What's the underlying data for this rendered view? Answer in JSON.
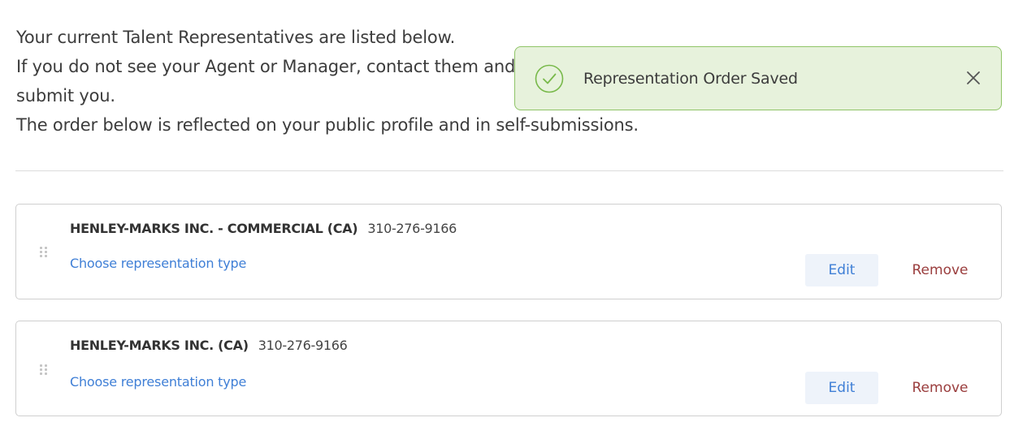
{
  "intro": {
    "line1": "Your current Talent Representatives are listed below.",
    "line2": "If you do not see your Agent or Manager, contact them and ask them to",
    "line3": "submit you.",
    "line4": "The order below is reflected on your public profile and in self-submissions."
  },
  "toast": {
    "message": "Representation Order Saved",
    "icon": "check-circle-icon",
    "close_icon": "close-icon",
    "color": "#e7f2dc",
    "border_color": "#8fc467"
  },
  "representatives": [
    {
      "name": "HENLEY-MARKS INC. - COMMERCIAL (CA)",
      "phone": "310-276-9166",
      "type_link": "Choose representation type",
      "edit_label": "Edit",
      "remove_label": "Remove"
    },
    {
      "name": "HENLEY-MARKS INC. (CA)",
      "phone": "310-276-9166",
      "type_link": "Choose representation type",
      "edit_label": "Edit",
      "remove_label": "Remove"
    }
  ],
  "colors": {
    "link": "#3f7fd6",
    "remove": "#9a3d3d",
    "edit_bg": "#eef3fa"
  }
}
